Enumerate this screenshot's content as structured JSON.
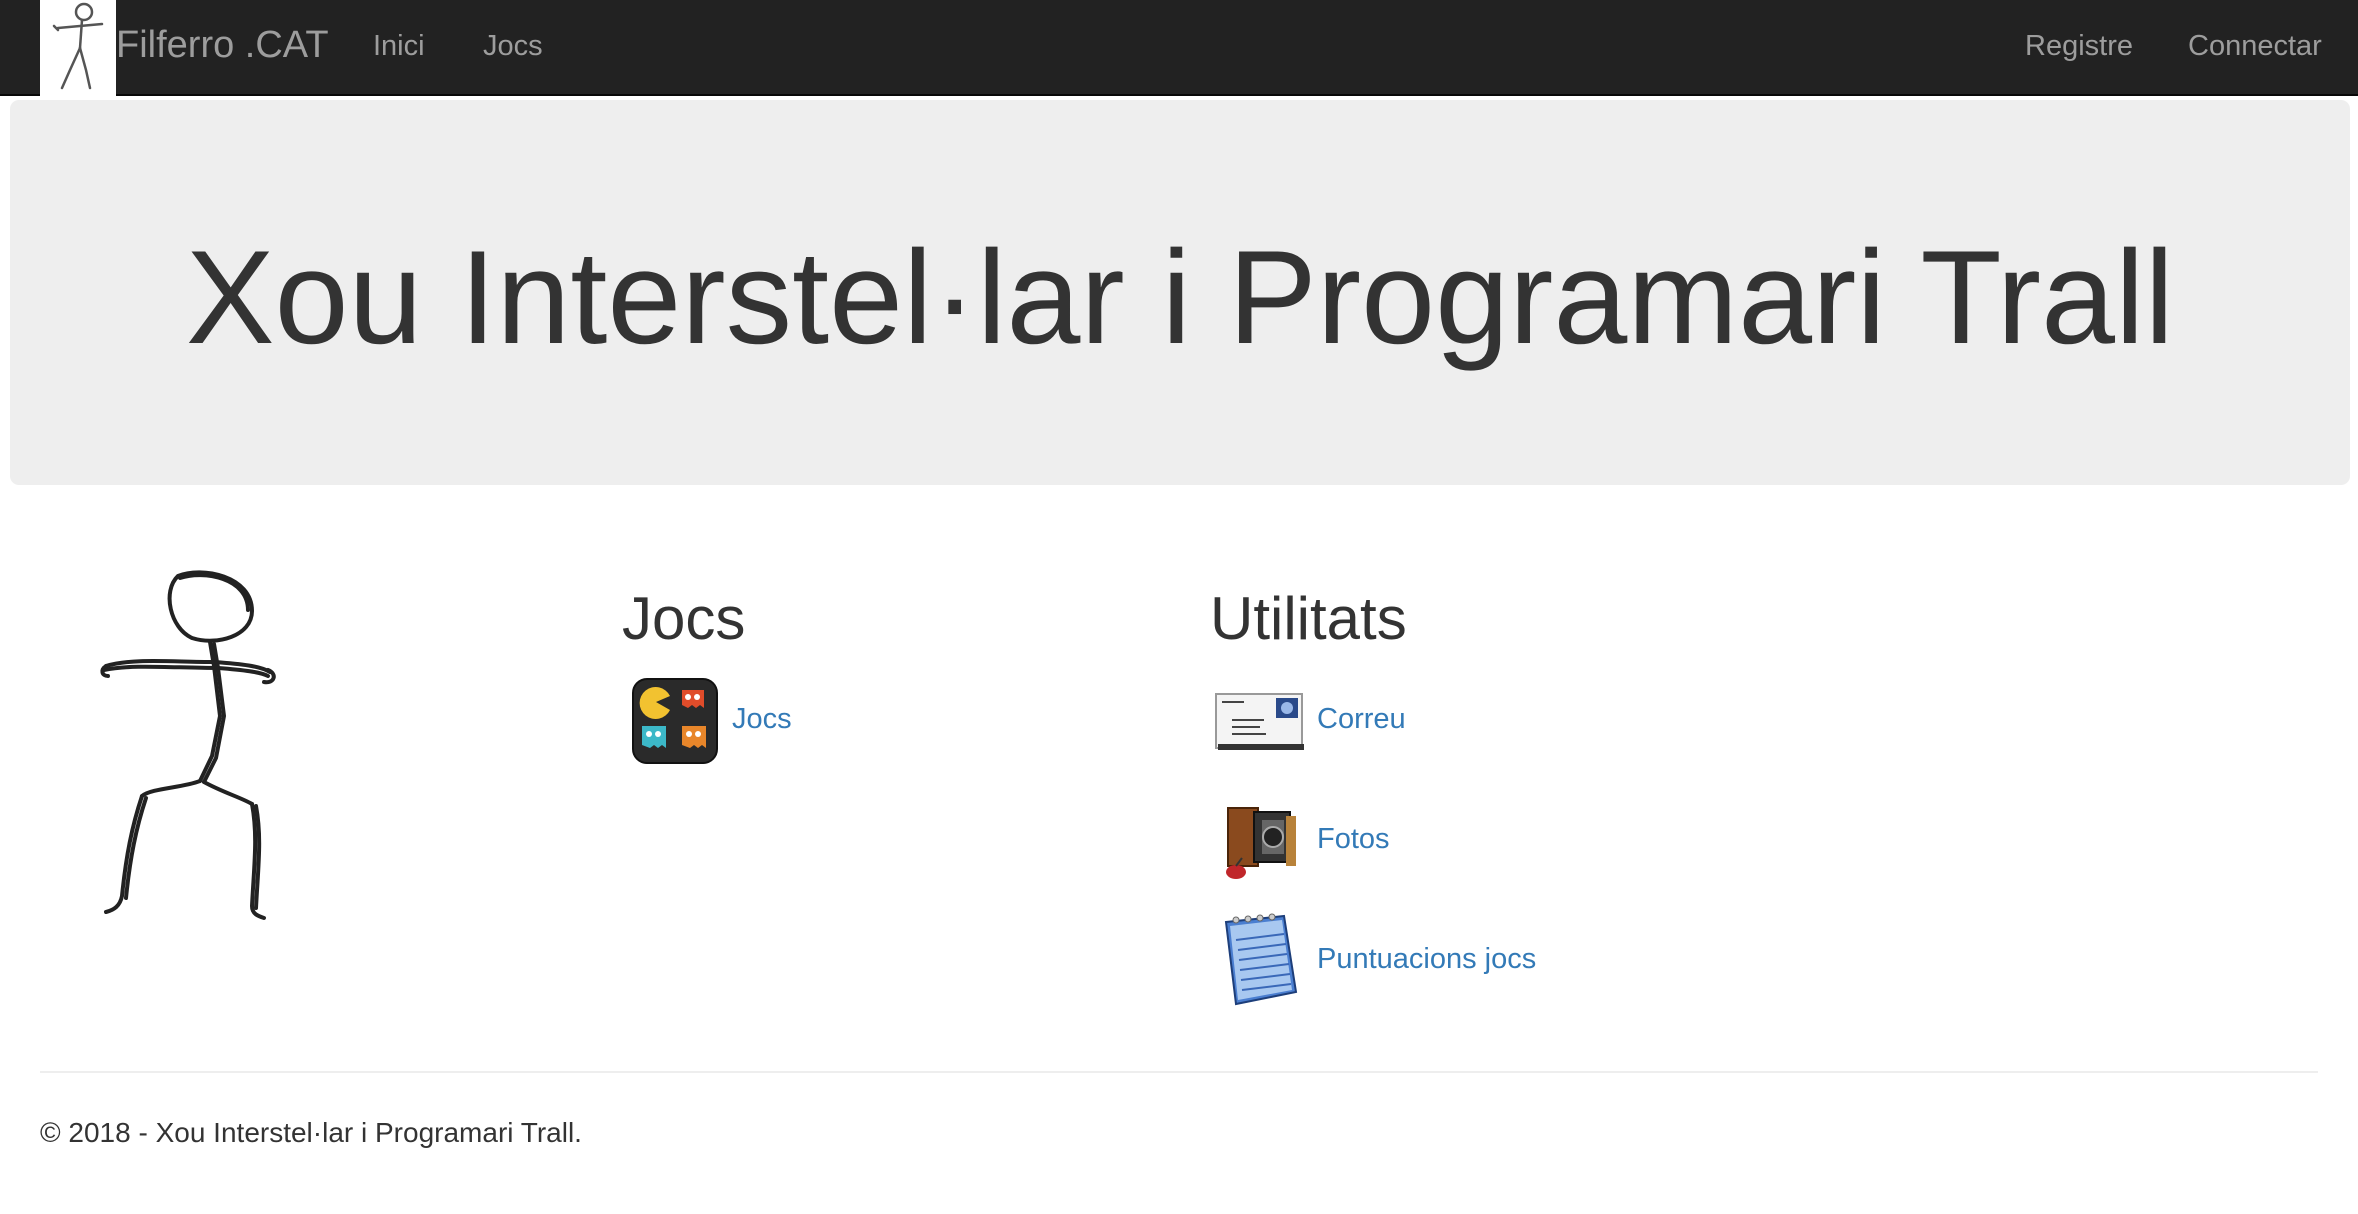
{
  "navbar": {
    "brand": "Filferro .CAT",
    "links_left": [
      {
        "label": "Inici"
      },
      {
        "label": "Jocs"
      }
    ],
    "links_right": [
      {
        "label": "Registre"
      },
      {
        "label": "Connectar"
      }
    ],
    "logo_icon": "stickman-logo-icon",
    "background": "#222222",
    "link_color": "#9d9d9d"
  },
  "jumbotron": {
    "title": "Xou Interstel·lar i Programari Trall",
    "background": "#eeeeee"
  },
  "sections": {
    "jocs": {
      "heading": "Jocs",
      "items": [
        {
          "label": "Jocs",
          "icon": "pacman-ghosts-icon"
        }
      ]
    },
    "utilitats": {
      "heading": "Utilitats",
      "items": [
        {
          "label": "Correu",
          "icon": "mail-envelope-icon"
        },
        {
          "label": "Fotos",
          "icon": "camera-icon"
        },
        {
          "label": "Puntuacions jocs",
          "icon": "notepad-icon"
        }
      ]
    }
  },
  "footer": {
    "text": "© 2018 - Xou Interstel·lar i Programari Trall."
  },
  "colors": {
    "link": "#337ab7",
    "text": "#333333"
  }
}
